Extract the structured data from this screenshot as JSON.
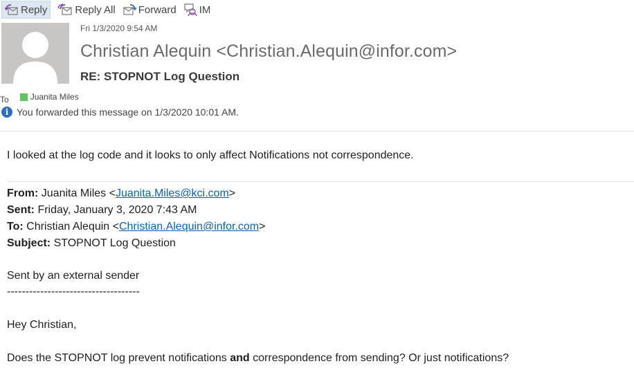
{
  "toolbar": {
    "reply": "Reply",
    "reply_all": "Reply All",
    "forward": "Forward",
    "im": "IM"
  },
  "header": {
    "date": "Fri 1/3/2020 9:54 AM",
    "sender": "Christian Alequin <Christian.Alequin@infor.com>",
    "subject": "RE: STOPNOT Log Question",
    "to_label": "To",
    "recipient": "Juanita Miles",
    "info_text": "You forwarded this message on 1/3/2020 10:01 AM."
  },
  "message": {
    "reply_text": "I looked at the log code and it looks to only affect Notifications not correspondence.",
    "quoted": {
      "from_label": "From:",
      "from_name": " Juanita Miles <",
      "from_email": "Juanita.Miles@kci.com",
      "from_end": ">",
      "sent_label": "Sent:",
      "sent_value": " Friday, January 3, 2020 7:43 AM",
      "to_label": "To:",
      "to_name": " Christian Alequin <",
      "to_email": "Christian.Alequin@infor.com",
      "to_end": ">",
      "subject_label": "Subject:",
      "subject_value": " STOPNOT Log Question"
    },
    "external_notice": "Sent by an external sender",
    "separator": "------------------------------------",
    "greeting": "Hey Christian,",
    "question_part1": "Does the STOPNOT log prevent notifications ",
    "question_bold": "and",
    "question_part2": " correspondence from sending? Or just notifications?"
  },
  "colors": {
    "link": "#0563c1",
    "presence": "#5cc85c",
    "info": "#2c6fc2",
    "avatar_bg": "#c8c6c4"
  }
}
